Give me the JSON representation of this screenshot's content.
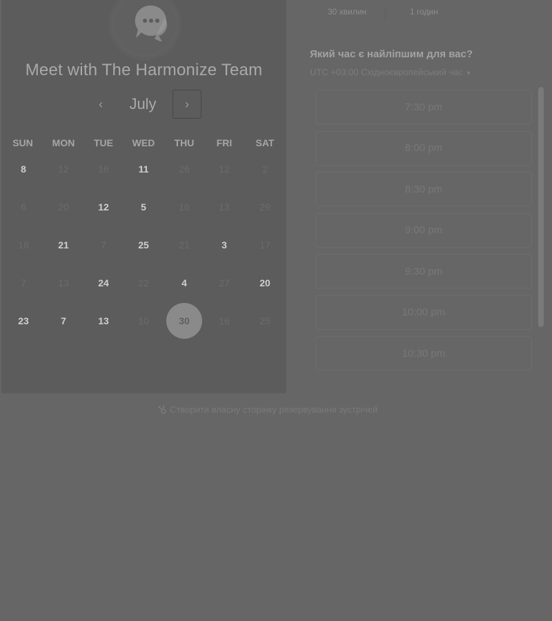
{
  "header": {
    "title": "Meet with The Harmonize Team",
    "logo_icon": "chat-bubble-logo-icon"
  },
  "durations": [
    "30 хвилин",
    "1 годин"
  ],
  "calendar": {
    "month": "July",
    "prev_icon": "chevron-left-icon",
    "next_icon": "chevron-right-icon",
    "weekdays": [
      "SUN",
      "MON",
      "TUE",
      "WED",
      "THU",
      "FRI",
      "SAT"
    ],
    "weeks": [
      [
        {
          "d": "8",
          "s": "available"
        },
        {
          "d": "12",
          "s": "muted"
        },
        {
          "d": "16",
          "s": "muted"
        },
        {
          "d": "11",
          "s": "available"
        },
        {
          "d": "26",
          "s": "muted"
        },
        {
          "d": "12",
          "s": "muted"
        },
        {
          "d": "2",
          "s": "muted"
        }
      ],
      [
        {
          "d": "6",
          "s": "muted"
        },
        {
          "d": "20",
          "s": "muted"
        },
        {
          "d": "12",
          "s": "available"
        },
        {
          "d": "5",
          "s": "available"
        },
        {
          "d": "16",
          "s": "muted"
        },
        {
          "d": "13",
          "s": "muted"
        },
        {
          "d": "29",
          "s": "muted"
        }
      ],
      [
        {
          "d": "18",
          "s": "muted"
        },
        {
          "d": "21",
          "s": "available"
        },
        {
          "d": "7",
          "s": "muted"
        },
        {
          "d": "25",
          "s": "available"
        },
        {
          "d": "21",
          "s": "muted"
        },
        {
          "d": "3",
          "s": "available"
        },
        {
          "d": "17",
          "s": "muted"
        }
      ],
      [
        {
          "d": "7",
          "s": "muted"
        },
        {
          "d": "13",
          "s": "muted"
        },
        {
          "d": "24",
          "s": "available"
        },
        {
          "d": "22",
          "s": "muted"
        },
        {
          "d": "4",
          "s": "available"
        },
        {
          "d": "27",
          "s": "muted"
        },
        {
          "d": "20",
          "s": "available"
        }
      ],
      [
        {
          "d": "23",
          "s": "available"
        },
        {
          "d": "7",
          "s": "available"
        },
        {
          "d": "13",
          "s": "available"
        },
        {
          "d": "10",
          "s": "muted"
        },
        {
          "d": "30",
          "s": "selected"
        },
        {
          "d": "16",
          "s": "muted"
        },
        {
          "d": "25",
          "s": "muted"
        }
      ]
    ]
  },
  "times": {
    "question": "Який час є найліпшим для вас?",
    "timezone": "UTC +03:00 Східноєвропейський час",
    "timezone_icon": "caret-down-icon",
    "slots": [
      "7:30 pm",
      "8:00 pm",
      "8:30 pm",
      "9:00 pm",
      "9:30 pm",
      "10:00 pm",
      "10:30 pm"
    ]
  },
  "footer": {
    "link": "Створити власну сторінку резервування зустрічей",
    "icon": "sprocket-icon"
  },
  "colors": {
    "overlay_bg": "#666666",
    "panel_bg": "#5c5c5c",
    "selected_day": "#8a8a8a"
  }
}
